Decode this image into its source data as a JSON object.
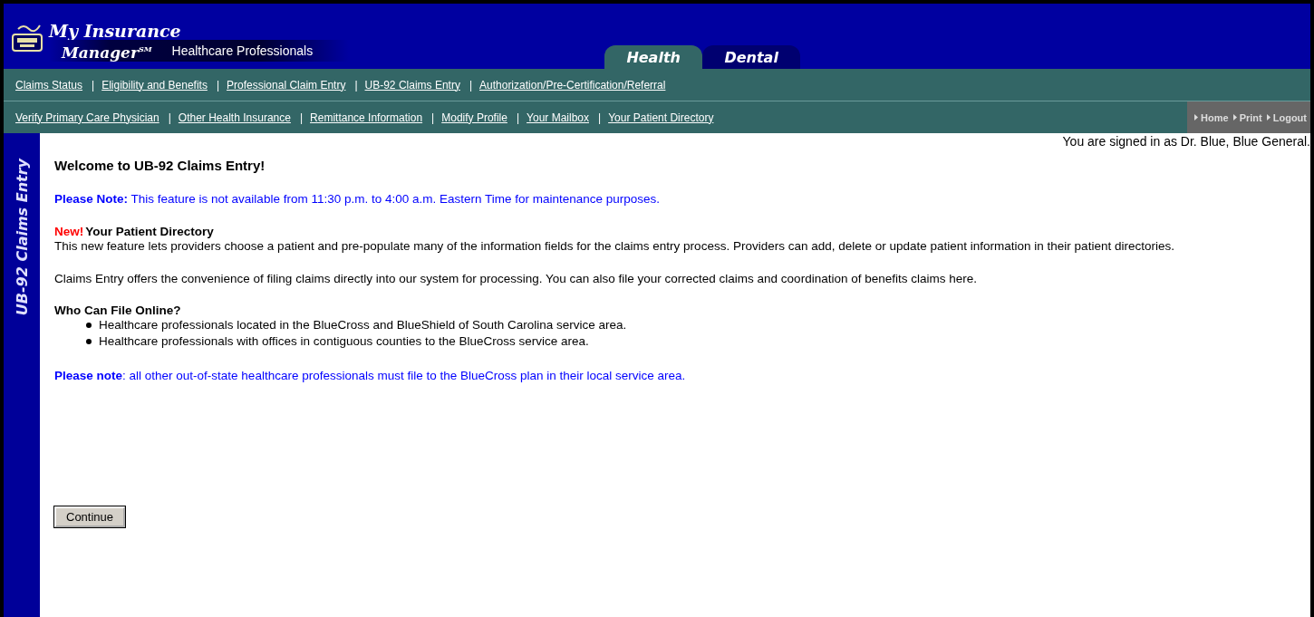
{
  "logo": {
    "line_1": "My Insurance",
    "line_2": "Manager$^{SM}$",
    "subtitle": "Healthcare Professionals"
  },
  "tabs": [
    {
      "label": "Health",
      "selected": true
    },
    {
      "label": "Dental",
      "selected": false
    }
  ],
  "nav_rows": [
    [
      {
        "kind": "link",
        "text": "Claims Status"
      },
      {
        "kind": "separator",
        "text": "|"
      },
      {
        "kind": "link",
        "text": "Eligibility and Benefits"
      },
      {
        "kind": "separator",
        "text": "|"
      },
      {
        "kind": "link",
        "text": "Professional Claim Entry"
      },
      {
        "kind": "separator",
        "text": "|"
      },
      {
        "kind": "link",
        "text": "UB-92 Claims Entry"
      },
      {
        "kind": "separator",
        "text": "|"
      },
      {
        "kind": "link",
        "text": "Authorization/Pre-Certification/Referral"
      }
    ],
    [
      {
        "kind": "link",
        "text": "Verify Primary Care Physician"
      },
      {
        "kind": "separator",
        "text": "|"
      },
      {
        "kind": "link",
        "text": "Other Health Insurance"
      },
      {
        "kind": "separator",
        "text": "|"
      },
      {
        "kind": "link",
        "text": "Remittance Information"
      },
      {
        "kind": "separator",
        "text": "|"
      },
      {
        "kind": "link",
        "text": "Modify Profile"
      },
      {
        "kind": "separator",
        "text": "|"
      },
      {
        "kind": "link",
        "text": "Your Mailbox"
      },
      {
        "kind": "separator",
        "text": "|"
      },
      {
        "kind": "link",
        "text": "Your Patient Directory"
      }
    ]
  ],
  "utility_links": [
    "Home",
    "Print",
    "Logout"
  ],
  "signed_in": "You are signed in as Dr. Blue, Blue General.",
  "sidebar_title": "UB-92 Claims Entry",
  "heading": "Welcome to UB-92 Claims Entry!",
  "maintenance_note": "**Please Note:** This feature is not available from 11:30 p.m. to 4:00 a.m. Eastern Time for maintenance purposes.",
  "feature": {
    "badge": "New!",
    "title": "Your Patient Directory",
    "text": "This new feature lets providers choose a patient and pre-populate many of the information fields for the claims entry process. Providers can add, delete or update patient information in their patient directories."
  },
  "intro": "Claims Entry offers the convenience of filing claims directly into our system for processing. You can also file your corrected claims and coordination of benefits claims here.",
  "who_heading": "Who Can File Online?",
  "who_items": [
    "Healthcare professionals located in the BlueCross and BlueShield of South Carolina service area.",
    "Healthcare professionals with offices in contiguous counties to the BlueCross service area."
  ],
  "out_of_state_note": "**Please note**: all other out-of-state healthcare professionals must file to the BlueCross plan in their local service area.",
  "continue_button": "Continue"
}
